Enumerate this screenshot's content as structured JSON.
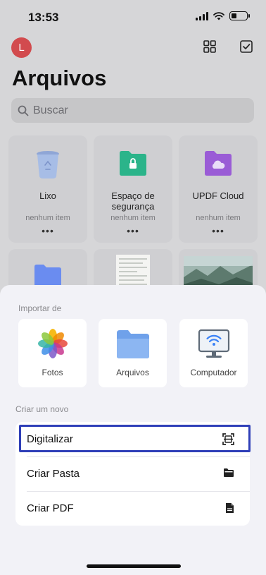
{
  "status_bar": {
    "time": "13:53"
  },
  "header": {
    "avatar_letter": "L",
    "title": "Arquivos"
  },
  "search": {
    "placeholder": "Buscar"
  },
  "folders": [
    {
      "name": "Lixo",
      "count": "nenhum item",
      "more": "•••"
    },
    {
      "name": "Espaço de segurança",
      "count": "nenhum item",
      "more": "•••"
    },
    {
      "name": "UPDF Cloud",
      "count": "nenhum item",
      "more": "•••"
    }
  ],
  "sheet": {
    "import_label": "Importar de",
    "import_sources": [
      {
        "label": "Fotos",
        "icon": "photos-icon"
      },
      {
        "label": "Arquivos",
        "icon": "files-folder-icon"
      },
      {
        "label": "Computador",
        "icon": "computer-wifi-icon"
      }
    ],
    "create_label": "Criar um novo",
    "actions": [
      {
        "label": "Digitalizar",
        "icon": "scan-icon"
      },
      {
        "label": "Criar Pasta",
        "icon": "folder-icon"
      },
      {
        "label": "Criar PDF",
        "icon": "document-icon"
      }
    ]
  },
  "colors": {
    "avatar": "#d24b4e",
    "highlight": "#2f3fb8",
    "folder_green": "#2bb48a",
    "folder_purple": "#9a5cd6",
    "folder_blue": "#6a8cf0"
  }
}
